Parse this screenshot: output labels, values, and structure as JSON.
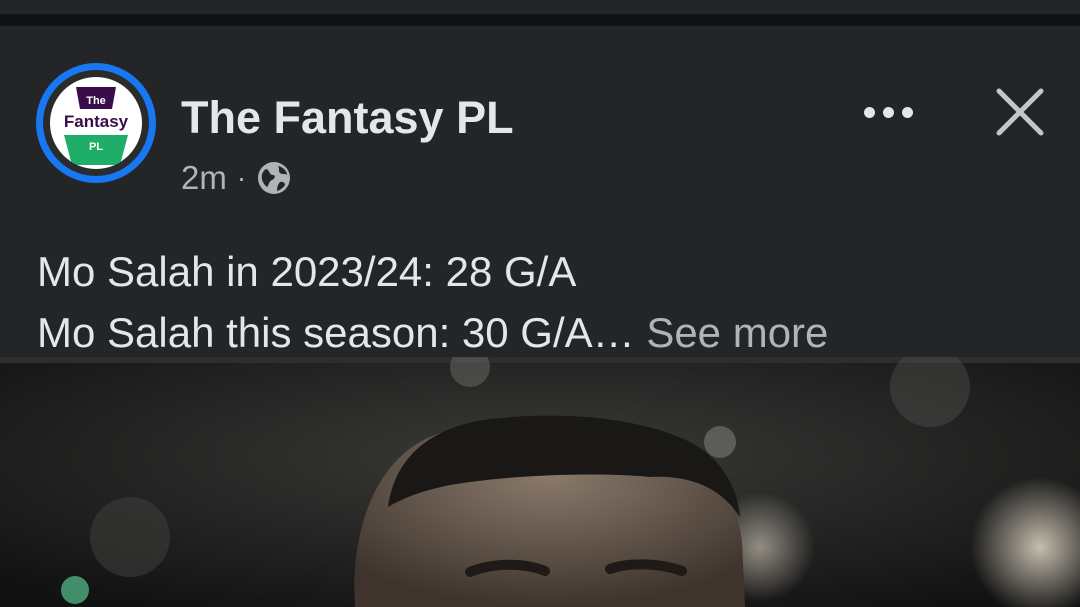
{
  "post": {
    "page_name": "The Fantasy PL",
    "timestamp": "2m",
    "separator": "·",
    "audience_icon": "globe-icon",
    "text_line_1": "Mo Salah in 2023/24: 28 G/A",
    "text_line_2": "Mo Salah this season: 30 G/A…",
    "see_more": "See more"
  },
  "avatar": {
    "logo_line_1": "The",
    "logo_line_2": "Fantasy",
    "logo_line_3": "PL",
    "ring_color": "#1877f2"
  },
  "actions": {
    "more_icon": "more-horizontal-icon",
    "close_icon": "close-icon"
  },
  "media": {
    "type": "photo"
  }
}
